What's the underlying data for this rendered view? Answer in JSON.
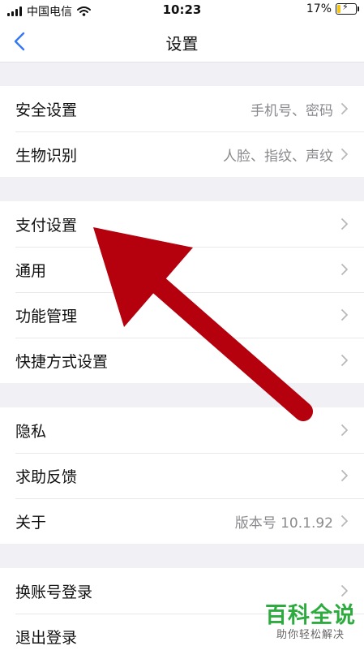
{
  "status_bar": {
    "carrier": "中国电信",
    "time": "10:23",
    "battery": "17%",
    "battery_level": 0.17,
    "battery_color": "#f2c318"
  },
  "nav": {
    "title": "设置",
    "back_icon": "chevron-left-icon",
    "accent": "#3478f6"
  },
  "groups": [
    {
      "items": [
        {
          "label": "安全设置",
          "value": "手机号、密码"
        },
        {
          "label": "生物识别",
          "value": "人脸、指纹、声纹"
        }
      ]
    },
    {
      "items": [
        {
          "label": "支付设置",
          "value": ""
        },
        {
          "label": "通用",
          "value": ""
        },
        {
          "label": "功能管理",
          "value": ""
        },
        {
          "label": "快捷方式设置",
          "value": ""
        }
      ]
    },
    {
      "items": [
        {
          "label": "隐私",
          "value": ""
        },
        {
          "label": "求助反馈",
          "value": ""
        },
        {
          "label": "关于",
          "value": "版本号 10.1.92"
        }
      ]
    },
    {
      "items": [
        {
          "label": "换账号登录",
          "value": ""
        },
        {
          "label": "退出登录",
          "value": ""
        }
      ]
    }
  ],
  "annotation": {
    "arrow_color": "#b5000d"
  },
  "watermark": {
    "title": "百科全说",
    "subtitle": "助你轻松解决"
  }
}
